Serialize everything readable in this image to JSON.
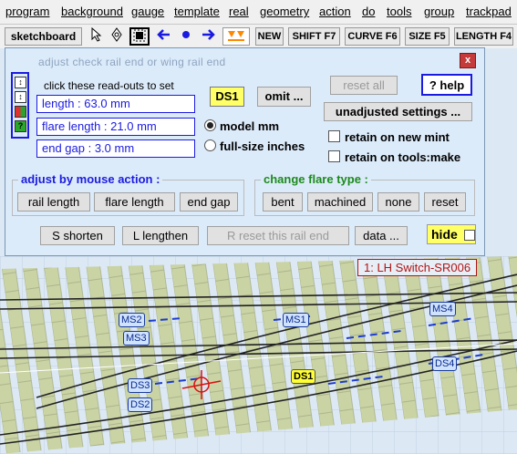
{
  "menu": [
    "program",
    "background",
    "gauge",
    "template",
    "real",
    "geometry",
    "action",
    "do",
    "tools",
    "group",
    "trackpad"
  ],
  "toolbar": {
    "sketchboard": "sketchboard",
    "new": "NEW",
    "shift": "SHIFT  F7",
    "curve": "CURVE  F6",
    "size": "SIZE  F5",
    "length": "LENGTH  F4"
  },
  "dialog": {
    "hint": "adjust  check  rail  end  or  wing  rail  end",
    "close": "x",
    "readout_hint": "click these read-outs to set",
    "length": "length :  63.0 mm",
    "flare_length": "flare length :  21.0 mm",
    "end_gap": "end gap :  3.0 mm",
    "ds_badge": "DS1",
    "omit": "omit ...",
    "reset_all": "reset  all",
    "help": "? help",
    "unadjusted": "unadjusted  settings ...",
    "model_mm": "model mm",
    "full_size": "full-size inches",
    "retain_mint": "retain on new mint",
    "retain_tools": "retain on tools:make",
    "adjust_title": "adjust by mouse  action :",
    "adjust_buttons": [
      "rail length",
      "flare length",
      "end gap"
    ],
    "flare_title": "change flare type :",
    "flare_buttons": [
      "bent",
      "machined",
      "none",
      "reset"
    ],
    "shorten": "S  shorten",
    "lengthen": "L  lengthen",
    "reset_rail_end": "R  reset  this  rail  end",
    "data": "data ...",
    "hide": "hide"
  },
  "canvas": {
    "switch_label": "1: LH Switch-SR006",
    "labels": [
      "MS2",
      "MS3",
      "MS1",
      "MS4",
      "DS3",
      "DS2",
      "DS1",
      "DS4"
    ]
  },
  "colors": {
    "accent_blue": "#1b1be0",
    "yellow": "#ffff66",
    "panel": "#dcebfa",
    "timber": "#c9d3a4",
    "rail": "#222222"
  }
}
